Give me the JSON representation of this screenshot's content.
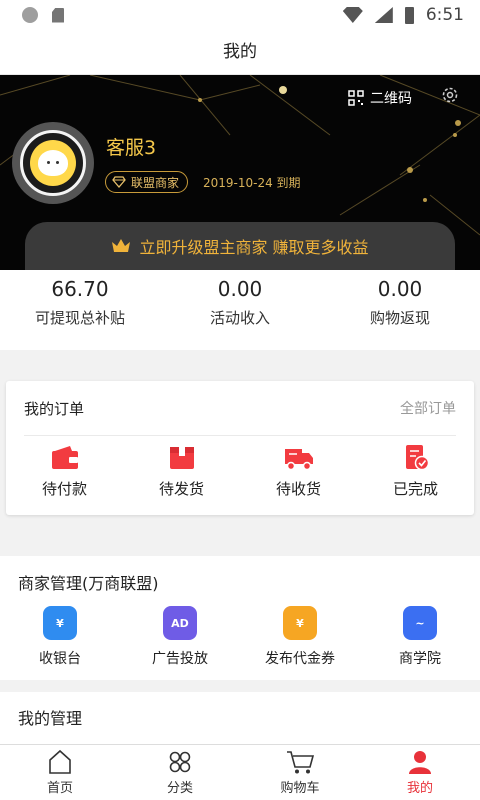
{
  "status_bar": {
    "time": "6:51"
  },
  "title_bar": {
    "title": "我的"
  },
  "header": {
    "qr_label": "二维码",
    "username": "客服3",
    "badge_label": "联盟商家",
    "expire_text": "2019-10-24 到期",
    "upgrade_text": "立即升级盟主商家  赚取更多收益",
    "colors": {
      "gold": "#f0b33a",
      "dark": "#050505",
      "banner": "#3a3a3a"
    }
  },
  "stats": [
    {
      "value": "66.70",
      "label": "可提现总补贴"
    },
    {
      "value": "0.00",
      "label": "活动收入"
    },
    {
      "value": "0.00",
      "label": "购物返现"
    }
  ],
  "orders": {
    "title": "我的订单",
    "all_label": "全部订单",
    "items": [
      {
        "label": "待付款",
        "icon": "wallet-icon"
      },
      {
        "label": "待发货",
        "icon": "package-icon"
      },
      {
        "label": "待收货",
        "icon": "truck-icon"
      },
      {
        "label": "已完成",
        "icon": "completed-icon"
      }
    ]
  },
  "merchant": {
    "title": "商家管理(万商联盟)",
    "items": [
      {
        "label": "收银台",
        "icon": "cashier-icon",
        "color": "#2f8cf0",
        "glyph": "¥"
      },
      {
        "label": "广告投放",
        "icon": "ad-icon",
        "color": "#6f5ce6",
        "glyph": "AD"
      },
      {
        "label": "发布代金券",
        "icon": "coupon-icon",
        "color": "#f6a623",
        "glyph": "¥"
      },
      {
        "label": "商学院",
        "icon": "school-icon",
        "color": "#3b6ff2",
        "glyph": "~"
      }
    ]
  },
  "my_management": {
    "title": "我的管理"
  },
  "tabbar": {
    "items": [
      {
        "label": "首页",
        "icon": "home-icon"
      },
      {
        "label": "分类",
        "icon": "category-icon"
      },
      {
        "label": "购物车",
        "icon": "cart-icon"
      },
      {
        "label": "我的",
        "icon": "profile-icon"
      }
    ],
    "active_color": "#e8323a"
  }
}
